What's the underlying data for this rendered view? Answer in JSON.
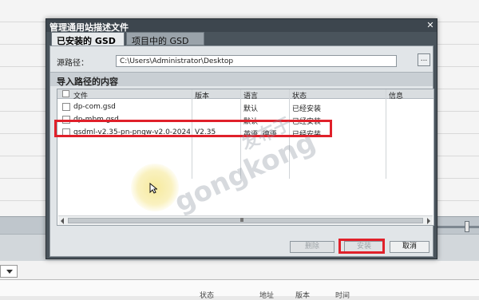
{
  "dialog": {
    "title": "管理通用站描述文件",
    "close_glyph": "✕",
    "tabs": [
      {
        "label": "已安装的 GSD",
        "active": true
      },
      {
        "label": "项目中的 GSD",
        "active": false
      }
    ],
    "source": {
      "label": "源路径：",
      "value": "C:\\Users\\Administrator\\Desktop",
      "browse_label": "..."
    },
    "section_title": "导入路径的内容",
    "table": {
      "columns": [
        "文件",
        "版本",
        "语言",
        "状态",
        "信息"
      ],
      "rows": [
        {
          "file": "dp-com.gsd",
          "version": "",
          "language": "默认",
          "status": "已经安装",
          "info": ""
        },
        {
          "file": "dp-mbm.gsd",
          "version": "",
          "language": "默认",
          "status": "已经安装",
          "info": ""
        },
        {
          "file": "gsdml-v2.35-pn-pngw-v2.0-2024...",
          "version": "V2.35",
          "language": "英语, 德语",
          "status": "已经安装",
          "info": ""
        }
      ]
    },
    "buttons": {
      "delete": "删除",
      "install": "安装",
      "cancel": "取消"
    }
  },
  "background": {
    "bottom_columns": [
      "状态",
      "",
      "地址",
      "",
      "版本",
      "时间"
    ]
  },
  "watermark": {
    "line1": "gongkong",
    "line2": "发布于"
  },
  "colors": {
    "highlight": "#e0202a",
    "dialog_frame": "#4a545c",
    "panel": "#e1e5e8"
  }
}
